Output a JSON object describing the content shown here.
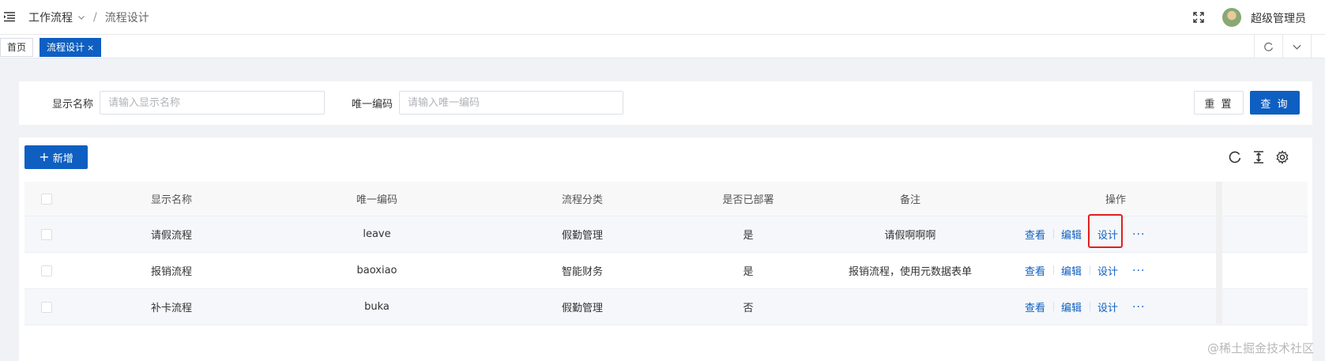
{
  "header": {
    "breadcrumb": [
      "工作流程",
      "流程设计"
    ],
    "separator": "/",
    "user_name": "超级管理员"
  },
  "tabs": [
    {
      "label": "首页",
      "active": false
    },
    {
      "label": "流程设计",
      "active": true,
      "close": "×"
    }
  ],
  "search": {
    "fields": [
      {
        "label": "显示名称",
        "placeholder": "请输入显示名称",
        "value": ""
      },
      {
        "label": "唯一编码",
        "placeholder": "请输入唯一编码",
        "value": ""
      }
    ],
    "reset_label": "重 置",
    "query_label": "查 询"
  },
  "toolbar": {
    "add_label": "新增"
  },
  "table": {
    "columns": [
      "显示名称",
      "唯一编码",
      "流程分类",
      "是否已部署",
      "备注",
      "操作"
    ],
    "rows": [
      {
        "name": "请假流程",
        "code": "leave",
        "category": "假勤管理",
        "deployed": "是",
        "remark": "请假啊啊啊"
      },
      {
        "name": "报销流程",
        "code": "baoxiao",
        "category": "智能财务",
        "deployed": "是",
        "remark": "报销流程，使用元数据表单"
      },
      {
        "name": "补卡流程",
        "code": "buka",
        "category": "假勤管理",
        "deployed": "否",
        "remark": ""
      }
    ],
    "actions": {
      "view": "查看",
      "edit": "编辑",
      "design": "设计",
      "more": "···"
    }
  },
  "watermark": "@稀土掘金技术社区",
  "colors": {
    "primary": "#0e5fc1",
    "highlight": "#e02020"
  }
}
